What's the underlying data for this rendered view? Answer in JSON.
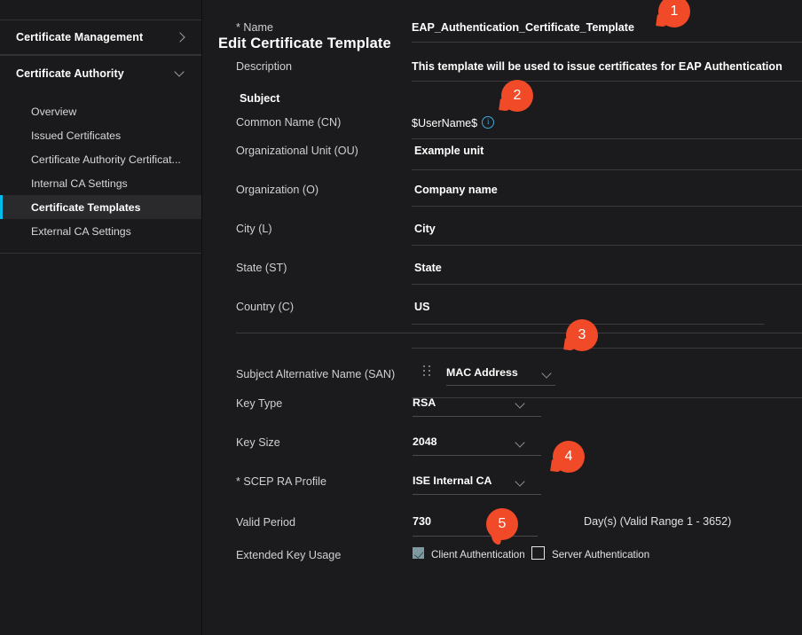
{
  "sidebar": {
    "groups": [
      {
        "label": "Certificate Management",
        "icon": "chevron-right-icon"
      },
      {
        "label": "Certificate Authority",
        "icon": "chevron-down-icon"
      }
    ],
    "items": [
      {
        "label": "Overview",
        "active": false
      },
      {
        "label": "Issued Certificates",
        "active": false
      },
      {
        "label": "Certificate Authority Certificat...",
        "active": false
      },
      {
        "label": "Internal CA Settings",
        "active": false
      },
      {
        "label": "Certificate Templates",
        "active": true
      },
      {
        "label": "External CA Settings",
        "active": false
      }
    ]
  },
  "page": {
    "title": "Edit Certificate Template"
  },
  "form": {
    "name": {
      "label": "* Name",
      "value": "EAP_Authentication_Certificate_Template"
    },
    "description": {
      "label": "Description",
      "value": "This template will be used to issue certificates for EAP Authentication"
    },
    "subject_heading": "Subject",
    "common_name": {
      "label": "Common Name (CN)",
      "value": "$UserName$",
      "info_icon": "info-icon"
    },
    "organizational_unit": {
      "label": "Organizational Unit (OU)",
      "value": "Example unit"
    },
    "organization": {
      "label": "Organization (O)",
      "value": "Company name"
    },
    "city": {
      "label": "City (L)",
      "value": "City"
    },
    "state": {
      "label": "State (ST)",
      "value": "State"
    },
    "country": {
      "label": "Country (C)",
      "value": "US"
    },
    "san": {
      "label": "Subject Alternative Name (SAN)",
      "value": "MAC Address",
      "drag_icon": "drag-handle-icon",
      "chevron_icon": "chevron-down-icon"
    },
    "key_type": {
      "label": "Key Type",
      "value": "RSA",
      "chevron_icon": "chevron-down-icon"
    },
    "key_size": {
      "label": "Key Size",
      "value": "2048",
      "chevron_icon": "chevron-down-icon"
    },
    "scep_ra_profile": {
      "label": "* SCEP RA Profile",
      "value": "ISE Internal CA",
      "chevron_icon": "chevron-down-icon"
    },
    "valid_period": {
      "label": "Valid Period",
      "value": "730",
      "suffix": "Day(s) (Valid Range 1 - 3652)"
    },
    "extended_key_usage": {
      "label": "Extended Key Usage",
      "client_auth": {
        "label": "Client Authentication",
        "checked": true
      },
      "server_auth": {
        "label": "Server Authentication",
        "checked": false
      }
    }
  },
  "callouts": [
    {
      "number": "1"
    },
    {
      "number": "2"
    },
    {
      "number": "3"
    },
    {
      "number": "4"
    },
    {
      "number": "5"
    }
  ],
  "colors": {
    "accent_cyan": "#00bceb",
    "callout_orange": "#f04a28",
    "background": "#1b1b1d",
    "sidebar_background": "#1a1a1c",
    "checkbox_checked": "#7e9aa0",
    "info_blue": "#3fa9d6"
  }
}
